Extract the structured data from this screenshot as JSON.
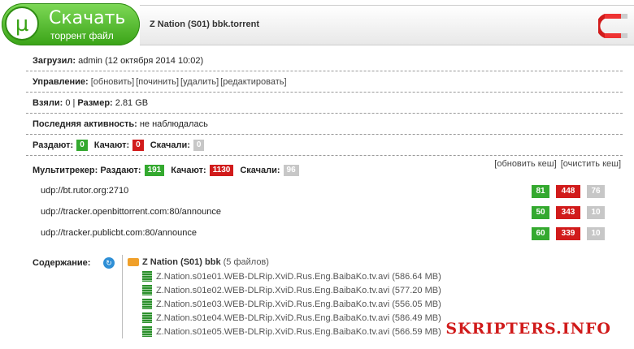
{
  "header": {
    "logo_glyph": "µ",
    "download_title": "Скачать",
    "download_sub": "торрент файл",
    "torrent_name": "Z Nation (S01) bbk.torrent"
  },
  "info": {
    "uploaded_label": "Загрузил:",
    "uploaded_value": "admin (12 октября 2014 10:02)",
    "manage_label": "Управление:",
    "manage_links": [
      "[обновить]",
      "[починить]",
      "[удалить]",
      "[редактировать]"
    ],
    "taken_label": "Взяли:",
    "taken_value": "0",
    "size_label": "Размер:",
    "size_value": "2.81 GB",
    "activity_label": "Последняя активность:",
    "activity_value": "не наблюдалась",
    "seed_label": "Раздают:",
    "seed_value": "0",
    "leech_label": "Качают:",
    "leech_value": "0",
    "done_label": "Скачали:",
    "done_value": "0"
  },
  "multitracker": {
    "label": "Мультитрекер:",
    "seed_label": "Раздают:",
    "seed_value": "191",
    "leech_label": "Качают:",
    "leech_value": "1130",
    "done_label": "Скачали:",
    "done_value": "96",
    "refresh_link": "[обновить кеш]",
    "clear_link": "[очистить кеш]",
    "trackers": [
      {
        "url": "udp://bt.rutor.org:2710",
        "seed": "81",
        "leech": "448",
        "done": "76"
      },
      {
        "url": "udp://tracker.openbittorrent.com:80/announce",
        "seed": "50",
        "leech": "343",
        "done": "10"
      },
      {
        "url": "udp://tracker.publicbt.com:80/announce",
        "seed": "60",
        "leech": "339",
        "done": "10"
      }
    ]
  },
  "content": {
    "label": "Содержание:",
    "folder_name": "Z Nation (S01) bbk",
    "folder_count": "(5 файлов)",
    "files": [
      "Z.Nation.s01e01.WEB-DLRip.XviD.Rus.Eng.BaibaKo.tv.avi (586.64 MB)",
      "Z.Nation.s01e02.WEB-DLRip.XviD.Rus.Eng.BaibaKo.tv.avi (577.20 MB)",
      "Z.Nation.s01e03.WEB-DLRip.XviD.Rus.Eng.BaibaKo.tv.avi (556.05 MB)",
      "Z.Nation.s01e04.WEB-DLRip.XviD.Rus.Eng.BaibaKo.tv.avi (586.49 MB)",
      "Z.Nation.s01e05.WEB-DLRip.XviD.Rus.Eng.BaibaKo.tv.avi (566.59 MB)"
    ]
  },
  "watermark": "SKRIPTERS.INFO",
  "colors": {
    "green": "#34a92f",
    "red": "#d11b1b",
    "gray": "#c7c7c7"
  }
}
